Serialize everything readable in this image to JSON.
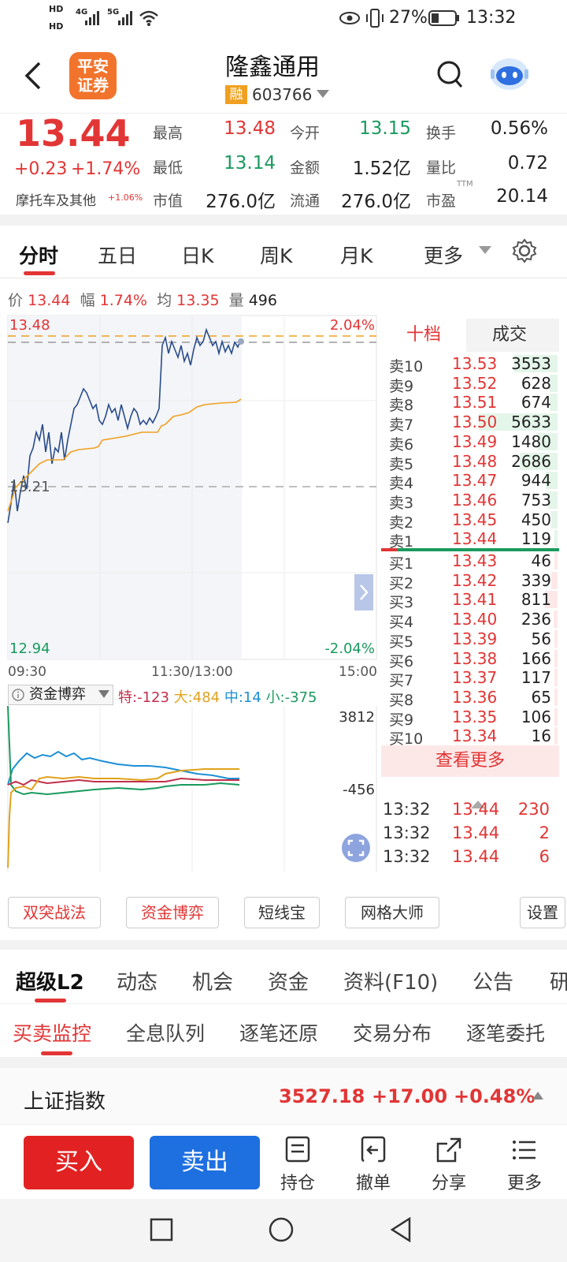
{
  "status_bar": {
    "time": "13:32",
    "battery": "27%",
    "net1": "4G",
    "net2": "5G",
    "hd1": "HD",
    "hd2": "HD"
  },
  "header": {
    "title": "隆鑫通用",
    "badge": "融",
    "code": "603766",
    "logo_line1": "平安",
    "logo_line2": "证券"
  },
  "quote": {
    "price": "13.44",
    "change": "+0.23",
    "change_pct": "+1.74%",
    "sector": "摩托车及其他",
    "sector_pct": "+1.06%",
    "fields": [
      {
        "label": "最高",
        "value": "13.48",
        "color": "red"
      },
      {
        "label": "今开",
        "value": "13.15",
        "color": "green"
      },
      {
        "label": "换手",
        "value": "0.56%",
        "color": "black"
      },
      {
        "label": "最低",
        "value": "13.14",
        "color": "green"
      },
      {
        "label": "金额",
        "value": "1.52亿",
        "color": "black"
      },
      {
        "label": "量比",
        "value": "0.72",
        "color": "black"
      },
      {
        "label": "市值",
        "value": "276.0亿",
        "color": "black"
      },
      {
        "label": "流通",
        "value": "276.0亿",
        "color": "black"
      },
      {
        "label": "市盈",
        "value": "20.14",
        "color": "black"
      }
    ],
    "ttm": "TTM"
  },
  "chart_tabs": [
    "分时",
    "五日",
    "日K",
    "周K",
    "月K",
    "更多"
  ],
  "info_line": {
    "price_label": "价",
    "price": "13.44",
    "amp_label": "幅",
    "amp": "1.74%",
    "avg_label": "均",
    "avg": "13.35",
    "vol_label": "量",
    "vol": "496"
  },
  "chart_data": {
    "type": "line",
    "ylim": [
      12.94,
      13.48
    ],
    "y_left_labels": [
      "13.48",
      "13.21",
      "12.94"
    ],
    "y_right_labels": [
      "2.04%",
      "-2.04%"
    ],
    "x_labels": [
      "09:30",
      "11:30/13:00",
      "15:00"
    ],
    "series": [],
    "note_prev_close": "13.21"
  },
  "capital": {
    "title": "资金博弈",
    "te_label": "特:",
    "te": "-123",
    "da_label": "大:",
    "da": "484",
    "zhong_label": "中:",
    "zhong": "14",
    "xiao_label": "小:",
    "xiao": "-375",
    "max": "3812",
    "min": "-456",
    "colors": {
      "te": "#c0304a",
      "da": "#e0a21c",
      "zhong": "#1d8fd6",
      "xiao": "#1a9a5e"
    }
  },
  "orderbook": {
    "tab_active": "十档",
    "tab_other": "成交",
    "sells": [
      {
        "label": "卖10",
        "price": "13.53",
        "vol": "3553",
        "fill": 0.55
      },
      {
        "label": "卖9",
        "price": "13.52",
        "vol": "628",
        "fill": 0.1
      },
      {
        "label": "卖8",
        "price": "13.51",
        "vol": "674",
        "fill": 0.1
      },
      {
        "label": "卖7",
        "price": "13.50",
        "vol": "5633",
        "fill": 1.0
      },
      {
        "label": "卖6",
        "price": "13.49",
        "vol": "1480",
        "fill": 0.25
      },
      {
        "label": "卖5",
        "price": "13.48",
        "vol": "2686",
        "fill": 0.48
      },
      {
        "label": "卖4",
        "price": "13.47",
        "vol": "944",
        "fill": 0.15
      },
      {
        "label": "卖3",
        "price": "13.46",
        "vol": "753",
        "fill": 0.12
      },
      {
        "label": "卖2",
        "price": "13.45",
        "vol": "450",
        "fill": 0.08
      },
      {
        "label": "卖1",
        "price": "13.44",
        "vol": "119",
        "fill": 0.03
      }
    ],
    "buys": [
      {
        "label": "买1",
        "price": "13.43",
        "vol": "46",
        "fill": 0.02
      },
      {
        "label": "买2",
        "price": "13.42",
        "vol": "339",
        "fill": 0.08
      },
      {
        "label": "买3",
        "price": "13.41",
        "vol": "811",
        "fill": 0.16
      },
      {
        "label": "买4",
        "price": "13.40",
        "vol": "236",
        "fill": 0.05
      },
      {
        "label": "买5",
        "price": "13.39",
        "vol": "56",
        "fill": 0.02
      },
      {
        "label": "买6",
        "price": "13.38",
        "vol": "166",
        "fill": 0.04
      },
      {
        "label": "买7",
        "price": "13.37",
        "vol": "117",
        "fill": 0.03
      },
      {
        "label": "买8",
        "price": "13.36",
        "vol": "65",
        "fill": 0.02
      },
      {
        "label": "买9",
        "price": "13.35",
        "vol": "106",
        "fill": 0.03
      },
      {
        "label": "买10",
        "price": "13.34",
        "vol": "16",
        "fill": 0.01
      }
    ],
    "more": "查看更多",
    "trades": [
      {
        "time": "13:32",
        "price": "13.44",
        "vol": "230"
      },
      {
        "time": "13:32",
        "price": "13.44",
        "vol": "2"
      },
      {
        "time": "13:32",
        "price": "13.44",
        "vol": "6"
      }
    ]
  },
  "tools": [
    "双突战法",
    "资金博弈",
    "短线宝",
    "网格大师",
    "设置"
  ],
  "tabs2": [
    "超级L2",
    "动态",
    "机会",
    "资金",
    "资料(F10)",
    "公告",
    "研"
  ],
  "tabs3": [
    "买卖监控",
    "全息队列",
    "逐笔还原",
    "交易分布",
    "逐笔委托"
  ],
  "index": {
    "name": "上证指数",
    "value": "3527.18",
    "change": "+17.00",
    "pct": "+0.48%"
  },
  "bottom": {
    "buy": "买入",
    "sell": "卖出",
    "hold": "持仓",
    "cancel": "撤单",
    "share": "分享",
    "more": "更多"
  }
}
